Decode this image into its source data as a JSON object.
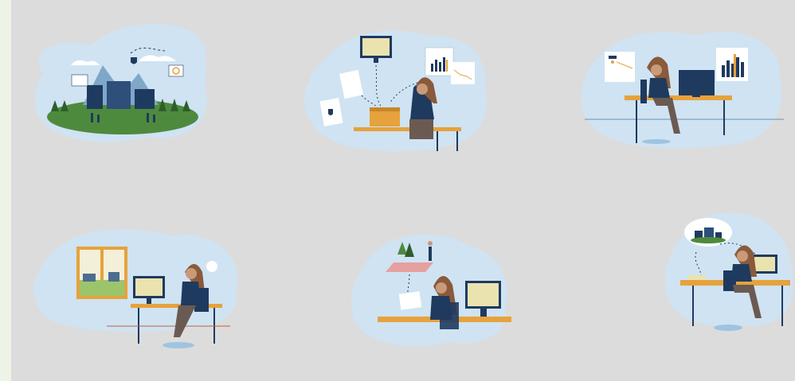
{
  "scenes": [
    {
      "name": "landscape-scene",
      "icon": "city-landscape-icon"
    },
    {
      "name": "data-collection-scene",
      "icon": "data-gathering-icon"
    },
    {
      "name": "analysis-scene",
      "icon": "chart-analysis-icon"
    },
    {
      "name": "office-window-scene",
      "icon": "window-desk-icon"
    },
    {
      "name": "field-report-scene",
      "icon": "field-map-icon"
    },
    {
      "name": "planning-scene",
      "icon": "thought-cloud-icon"
    }
  ],
  "colors": {
    "blob": "#cfe3f3",
    "navy": "#1f3a5f",
    "desk": "#e6a23c",
    "hair": "#8a5a3a",
    "pants": "#6b5a52",
    "grass": "#4e8a3e",
    "grid": "#dcdcdc",
    "background": "#efefef"
  }
}
